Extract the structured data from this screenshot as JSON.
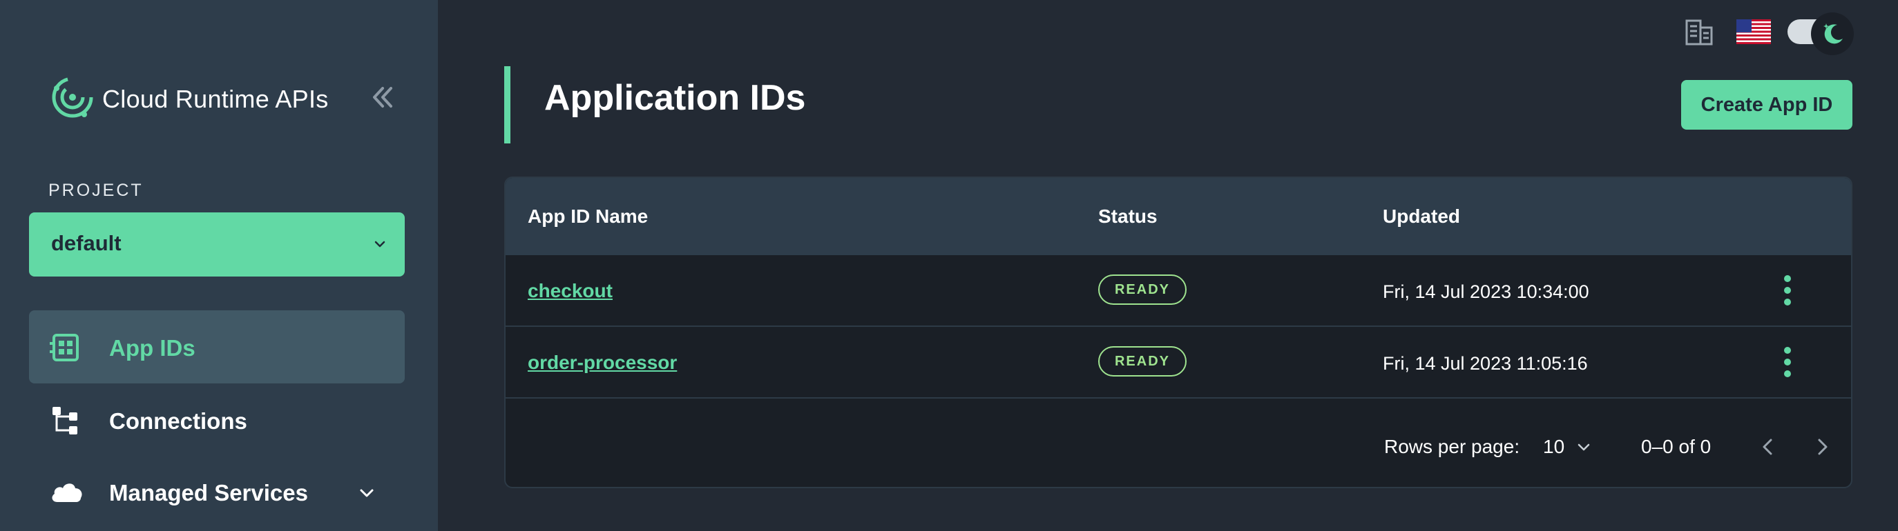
{
  "app": {
    "name": "Cloud Runtime APIs"
  },
  "sidebar": {
    "project_label": "PROJECT",
    "project_value": "default",
    "items": [
      {
        "label": "App IDs",
        "icon": "app-id-icon",
        "active": true
      },
      {
        "label": "Connections",
        "icon": "connections-icon"
      },
      {
        "label": "Managed Services",
        "icon": "cloud-icon",
        "expandable": true
      }
    ]
  },
  "header": {
    "icons": [
      "docs-icon",
      "us-flag-icon",
      "theme-toggle"
    ]
  },
  "main": {
    "title": "Application IDs",
    "create_button": "Create App ID",
    "table": {
      "columns": [
        "App ID Name",
        "Status",
        "Updated"
      ],
      "rows": [
        {
          "name": "checkout",
          "status": "READY",
          "updated": "Fri, 14 Jul 2023 10:34:00"
        },
        {
          "name": "order-processor",
          "status": "READY",
          "updated": "Fri, 14 Jul 2023 11:05:16"
        }
      ],
      "footer": {
        "rows_per_page_label": "Rows per page:",
        "rows_per_page_value": "10",
        "range": "0–0 of 0"
      }
    }
  },
  "colors": {
    "accent": "#62d9a5",
    "sidebar_bg": "#2e3d4b",
    "main_bg": "#232a34",
    "table_bg": "#1a1f26",
    "status_ready": "#9fe38f"
  }
}
